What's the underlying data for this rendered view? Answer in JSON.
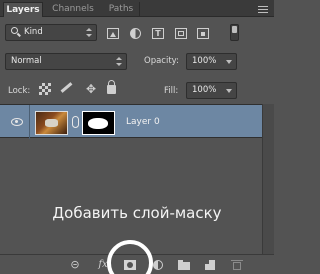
{
  "tabs": [
    {
      "label": "Layers",
      "active": true
    },
    {
      "label": "Channels",
      "active": false
    },
    {
      "label": "Paths",
      "active": false
    }
  ],
  "filter": {
    "kind_label": "Kind",
    "icons": [
      "image-filter-icon",
      "adjustment-filter-icon",
      "type-filter-icon",
      "shape-filter-icon",
      "smart-object-filter-icon"
    ]
  },
  "blend": {
    "mode": "Normal",
    "opacity_label": "Opacity:",
    "opacity_value": "100%"
  },
  "lock": {
    "label": "Lock:",
    "fill_label": "Fill:",
    "fill_value": "100%"
  },
  "layer": {
    "name": "Layer 0"
  },
  "hint_text": "Добавить слой-маску",
  "bottom_icons": [
    "link-layers-icon",
    "fx-icon",
    "add-mask-icon",
    "adjustment-layer-icon",
    "group-folder-icon",
    "new-layer-icon",
    "trash-icon"
  ],
  "colors": {
    "panel_bg": "#535353",
    "selected_layer": "#6d87a3",
    "tabbar_bg": "#3a3a3a"
  }
}
